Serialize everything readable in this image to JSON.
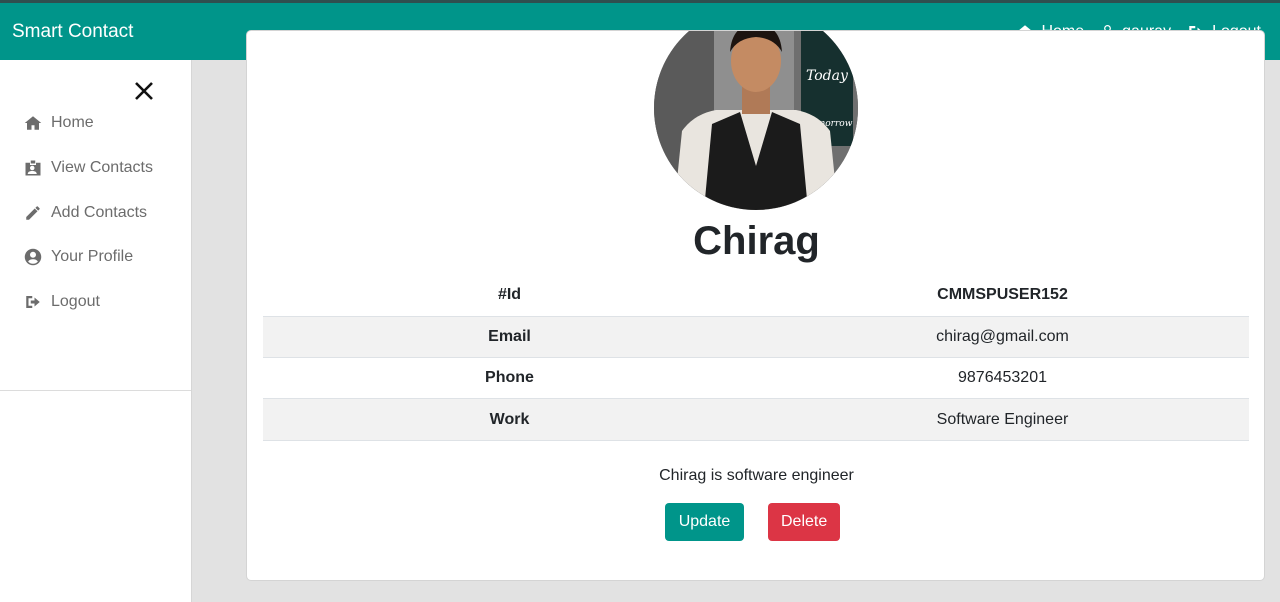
{
  "navbar": {
    "brand": "Smart Contact",
    "links": [
      {
        "label": "Home",
        "icon": "home-icon"
      },
      {
        "label": "gaurav",
        "icon": "user-icon"
      },
      {
        "label": "Logout",
        "icon": "logout-icon"
      }
    ]
  },
  "sidebar": {
    "close_icon": "close-icon",
    "items": [
      {
        "label": "Home",
        "icon": "home-icon"
      },
      {
        "label": "View Contacts",
        "icon": "id-badge-icon"
      },
      {
        "label": "Add Contacts",
        "icon": "pencil-icon"
      },
      {
        "label": "Your Profile",
        "icon": "user-circle-icon"
      },
      {
        "label": "Logout",
        "icon": "logout-icon"
      }
    ]
  },
  "contact": {
    "name": "Chirag",
    "rows": [
      {
        "label": "#Id",
        "value": "CMMSPUSER152"
      },
      {
        "label": "Email",
        "value": "chirag@gmail.com"
      },
      {
        "label": "Phone",
        "value": "9876453201"
      },
      {
        "label": "Work",
        "value": "Software Engineer"
      }
    ],
    "description": "Chirag is software engineer",
    "avatar_signs": [
      "Today",
      "Tomorrow"
    ]
  },
  "actions": {
    "update_label": "Update",
    "delete_label": "Delete"
  },
  "colors": {
    "primary": "#00958a",
    "danger": "#dc3545"
  }
}
